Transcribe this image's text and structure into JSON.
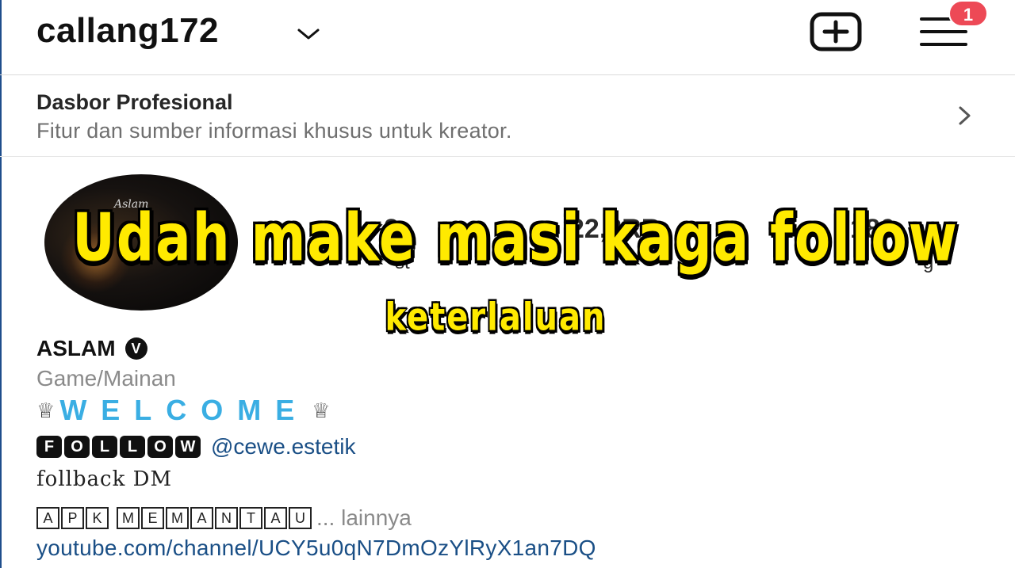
{
  "header": {
    "username": "callang172",
    "notification_count": "1"
  },
  "dashboard": {
    "title": "Dasbor Profesional",
    "subtitle": "Fitur dan sumber informasi khusus untuk kreator."
  },
  "avatar": {
    "signature": "Aslam"
  },
  "overlay": {
    "line1": "Udah make masi kaga follow",
    "line2": "keterlaluan"
  },
  "stats_partial": {
    "posts_value": "2",
    "followers_value": "22,3RB",
    "following_value": "180",
    "posts_label": "st",
    "following_label": "g"
  },
  "profile": {
    "name": "ASLAM",
    "verified_glyph": "V",
    "category": "Game/Mainan",
    "crown": "♕",
    "welcome": "WELCOME",
    "follow_letters": [
      "F",
      "O",
      "L",
      "L",
      "O",
      "W"
    ],
    "mention": "@cewe.estetik",
    "fb_dm": "follback DM",
    "apk_word1": [
      "A",
      "P",
      "K"
    ],
    "apk_word2": [
      "M",
      "E",
      "M",
      "A",
      "N",
      "T",
      "A",
      "U"
    ],
    "more": "... lainnya",
    "link": "youtube.com/channel/UCY5u0qN7DmOzYlRyX1an7DQ"
  },
  "colors": {
    "accent_blue": "#3aaee3",
    "link_blue": "#1a4f86",
    "badge_red": "#ed4956",
    "caption_yellow": "#ffea00"
  }
}
